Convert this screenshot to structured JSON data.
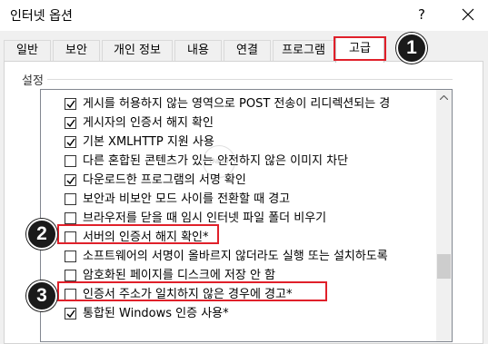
{
  "window": {
    "title": "인터넷 옵션",
    "help_label": "?"
  },
  "tabs": [
    {
      "label": "일반"
    },
    {
      "label": "보안"
    },
    {
      "label": "개인 정보"
    },
    {
      "label": "내용"
    },
    {
      "label": "연결"
    },
    {
      "label": "프로그램"
    },
    {
      "label": "고급"
    }
  ],
  "active_tab": "고급",
  "group": {
    "label": "설정"
  },
  "settings": [
    {
      "label": "게시를 허용하지 않는 영역으로 POST 전송이 리디렉션되는 경",
      "checked": true
    },
    {
      "label": "게시자의 인증서 해지 확인",
      "checked": true
    },
    {
      "label": "기본 XMLHTTP 지원 사용",
      "checked": true
    },
    {
      "label": "다른 혼합된 콘텐츠가 있는 안전하지 않은 이미지 차단",
      "checked": false
    },
    {
      "label": "다운로드한 프로그램의 서명 확인",
      "checked": true
    },
    {
      "label": "보안과 비보안 모드 사이를 전환할 때 경고",
      "checked": false
    },
    {
      "label": "브라우저를 닫을 때 임시 인터넷 파일 폴더 비우기",
      "checked": false
    },
    {
      "label": "서버의 인증서 해지 확인*",
      "checked": false
    },
    {
      "label": "소프트웨어의 서명이 올바르지 않더라도 실행 또는 설치하도록",
      "checked": false
    },
    {
      "label": "암호화된 페이지를 디스크에 저장 안 함",
      "checked": false
    },
    {
      "label": "인증서 주소가 일치하지 않은 경우에 경고*",
      "checked": false
    },
    {
      "label": "통합된 Windows 인증 사용*",
      "checked": true
    }
  ],
  "callouts": [
    "1",
    "2",
    "3"
  ],
  "watermark": "Dapp",
  "colors": {
    "highlight": "#e0202a",
    "callout_bg": "#1a1a1a"
  }
}
